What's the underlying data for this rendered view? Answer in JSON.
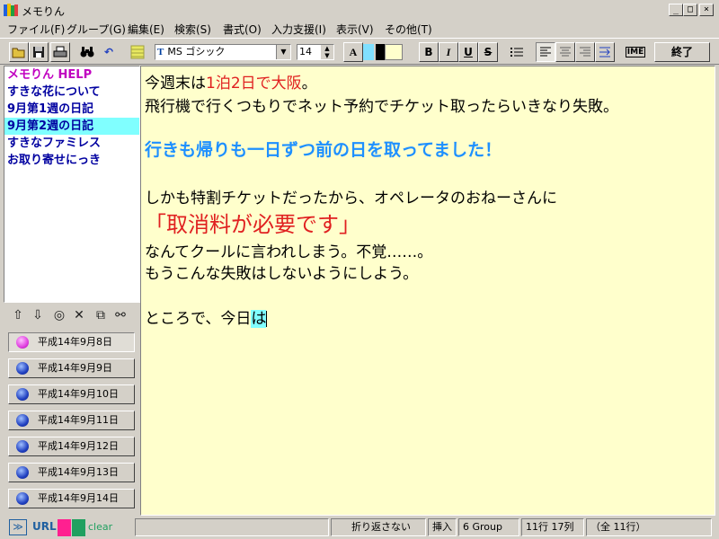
{
  "window": {
    "title": "メモりん"
  },
  "menu": [
    "ファイル(F)",
    "グループ(G)",
    "編集(E)",
    "検索(S)",
    "書式(O)",
    "入力支援(I)",
    "表示(V)",
    "その他(T)"
  ],
  "toolbar": {
    "font_name": "MS ゴシック",
    "font_size": "14",
    "font_icon": "T",
    "color_a": "A",
    "bold": "B",
    "italic": "I",
    "underline": "U",
    "strike": "S",
    "ime": "IME",
    "exit": "終了"
  },
  "entries": [
    {
      "label": "メモりん HELP"
    },
    {
      "label": "すきな花について"
    },
    {
      "label": "9月第1週の日記"
    },
    {
      "label": "9月第2週の日記"
    },
    {
      "label": "すきなファミレス"
    },
    {
      "label": "お取り寄せにっき"
    }
  ],
  "dates": [
    "平成14年9月8日",
    "平成14年9月9日",
    "平成14年9月10日",
    "平成14年9月11日",
    "平成14年9月12日",
    "平成14年9月13日",
    "平成14年9月14日"
  ],
  "editor": {
    "l1a": "今週末は",
    "l1b": "1泊2日で大阪",
    "l1c": "。",
    "l2": "飛行機で行くつもりでネット予約でチケット取ったらいきなり失敗。",
    "l3": "行きも帰りも一日ずつ前の日を取ってました！",
    "l4": "しかも特割チケットだったから、オペレータのおねーさんに",
    "l5": "「取消料が必要です」",
    "l6": "なんてクールに言われしまう。不覚……。",
    "l7": "もうこんな失敗はしないようにしよう。",
    "l8a": "ところで、今日",
    "l8b": "は"
  },
  "status": {
    "url": "URL",
    "clear": "clear",
    "wrap": "折り返さない",
    "mode": "挿入",
    "group": "6 Group",
    "pos": "11行 17列",
    "total": "（全 11行）"
  },
  "colors": {
    "red": "#e02020",
    "blue": "#1e90ff",
    "pink": "#ff2090",
    "green": "#20a060",
    "highlight": "#80ffff",
    "editor_bg": "#ffffcc"
  }
}
